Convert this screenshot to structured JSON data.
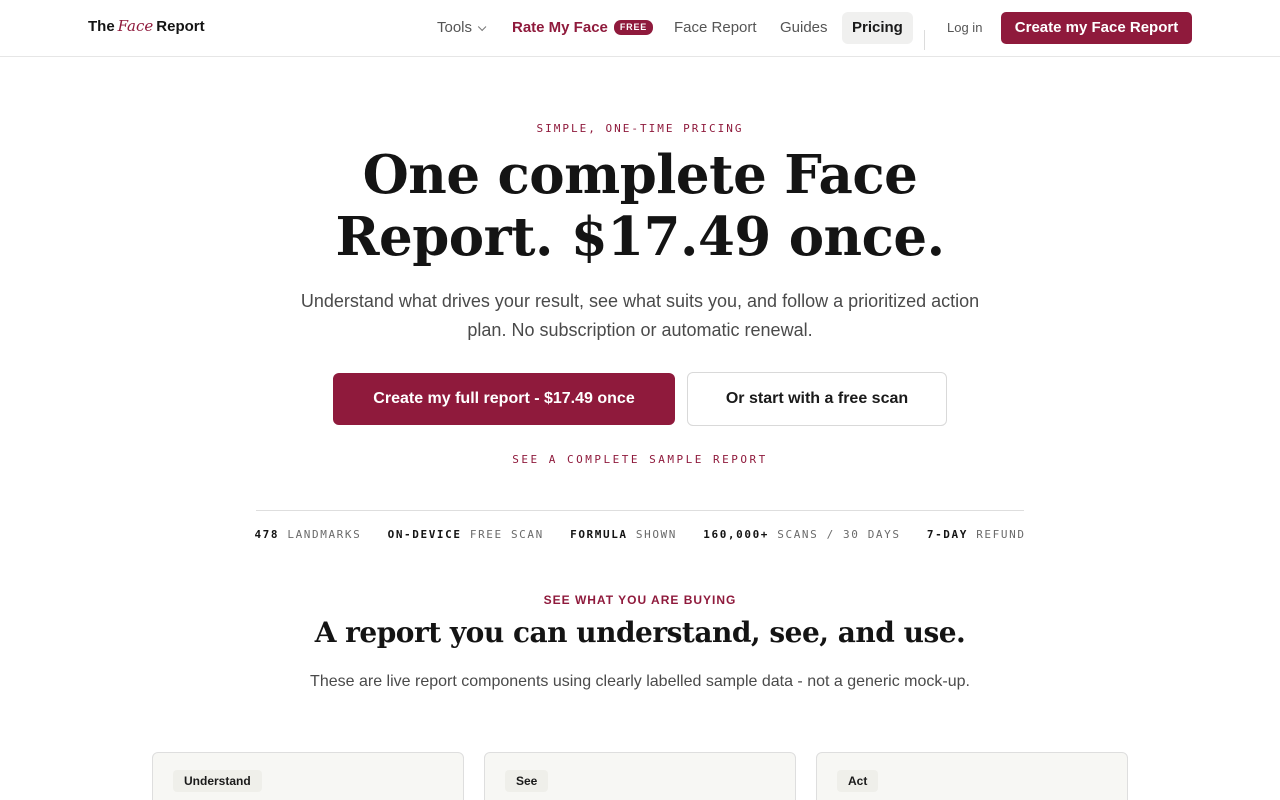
{
  "header": {
    "logo": {
      "before": "The",
      "mid": "Face",
      "after": "Report"
    },
    "nav": {
      "tools": "Tools",
      "rate_my_face": "Rate My Face",
      "rate_badge": "FREE",
      "face_report": "Face Report",
      "guides": "Guides",
      "pricing": "Pricing",
      "login": "Log in"
    },
    "cta": "Create my Face Report"
  },
  "hero": {
    "eyebrow": "SIMPLE, ONE-TIME PRICING",
    "title_line1": "One complete Face",
    "title_line2": "Report. $17.49 once.",
    "subtitle": "Understand what drives your result, see what suits you, and follow a prioritized action plan. No subscription or automatic renewal.",
    "primary_cta": "Create my full report - $17.49 once",
    "secondary_cta": "Or start with a free scan",
    "sample_link": "SEE A COMPLETE SAMPLE REPORT"
  },
  "stats": [
    {
      "key": "478",
      "value": "LANDMARKS"
    },
    {
      "key": "ON-DEVICE",
      "value": "FREE SCAN"
    },
    {
      "key": "FORMULA",
      "value": "SHOWN"
    },
    {
      "key": "160,000+",
      "value": "SCANS / 30 DAYS"
    },
    {
      "key": "7-DAY",
      "value": "REFUND"
    }
  ],
  "section": {
    "eyebrow": "SEE WHAT YOU ARE BUYING",
    "title": "A report you can understand, see, and use.",
    "subtitle": "These are live report components using clearly labelled sample data - not a generic mock-up.",
    "cards": [
      {
        "tag": "Understand"
      },
      {
        "tag": "See"
      },
      {
        "tag": "Act"
      }
    ]
  },
  "colors": {
    "accent": "#8f1a3c",
    "text": "#141414",
    "muted": "#4a4a4a"
  }
}
